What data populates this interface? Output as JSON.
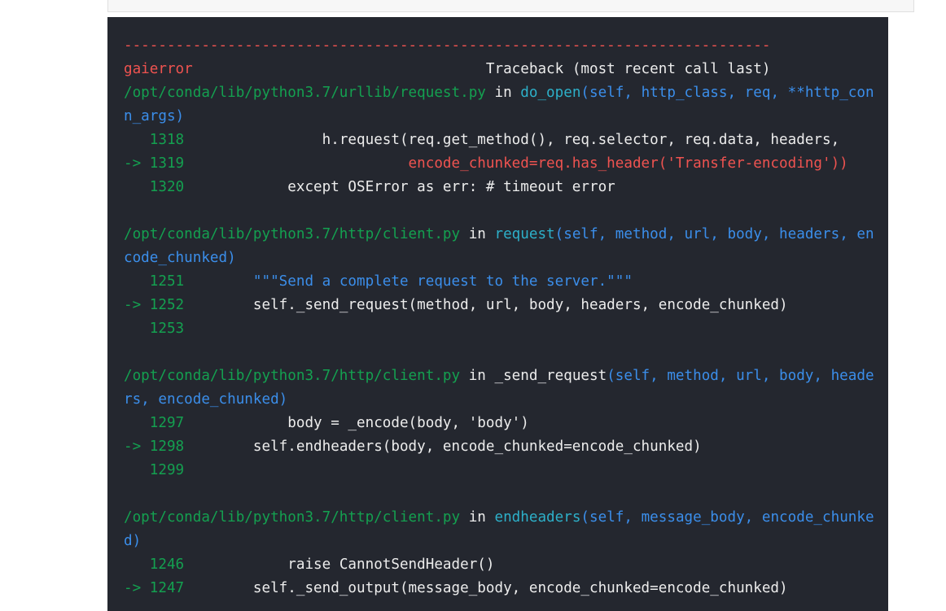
{
  "colors": {
    "background": "#24272f",
    "red": "#ef5350",
    "green": "#14a050",
    "blue": "#3b8eea",
    "cyan": "#2db0c9",
    "text": "#ececec"
  },
  "traceback": {
    "separator": "---------------------------------------------------------------------------",
    "error_name": "gaierror",
    "header": "Traceback (most recent call last)",
    "frames": [
      {
        "path": "/opt/conda/lib/python3.7/urllib/request.py",
        "in": "in",
        "func": "do_open",
        "signature_line1": "(self, http_class, req, **http_con",
        "signature_line2": "n_args)",
        "lines": [
          {
            "marker": "   ",
            "num": "1318",
            "pre": "",
            "code": "                h.request(req.get_method(), req.selector, req.data, headers,"
          },
          {
            "marker": "-> ",
            "num": "1319",
            "pre": "",
            "code": "                          encode_chunked=req.has_header('Transfer-encoding'))"
          },
          {
            "marker": "   ",
            "num": "1320",
            "pre": "",
            "code": "            except OSError as err: # timeout error"
          }
        ]
      },
      {
        "path": "/opt/conda/lib/python3.7/http/client.py",
        "in": "in",
        "func": "request",
        "signature_line1": "(self, method, url, body, headers, en",
        "signature_line2": "code_chunked)",
        "lines": [
          {
            "marker": "   ",
            "num": "1251",
            "code": "        \"\"\"Send a complete request to the server.\"\"\""
          },
          {
            "marker": "-> ",
            "num": "1252",
            "code": "        self._send_request(method, url, body, headers, encode_chunked)"
          },
          {
            "marker": "   ",
            "num": "1253",
            "code": ""
          }
        ]
      },
      {
        "path": "/opt/conda/lib/python3.7/http/client.py",
        "in": "in",
        "func": "_send_request",
        "signature_line1": "(self, method, url, body, heade",
        "signature_line2": "rs, encode_chunked)",
        "lines": [
          {
            "marker": "   ",
            "num": "1297",
            "code": "            body = _encode(body, 'body')"
          },
          {
            "marker": "-> ",
            "num": "1298",
            "code": "        self.endheaders(body, encode_chunked=encode_chunked)"
          },
          {
            "marker": "   ",
            "num": "1299",
            "code": ""
          }
        ]
      },
      {
        "path": "/opt/conda/lib/python3.7/http/client.py",
        "in": "in",
        "func": "endheaders",
        "signature_line1": "(self, message_body, encode_chunke",
        "signature_line2": "d)",
        "lines": [
          {
            "marker": "   ",
            "num": "1246",
            "code": "            raise CannotSendHeader()"
          },
          {
            "marker": "-> ",
            "num": "1247",
            "code": "        self._send_output(message_body, encode_chunked=encode_chunked)"
          }
        ]
      }
    ]
  }
}
